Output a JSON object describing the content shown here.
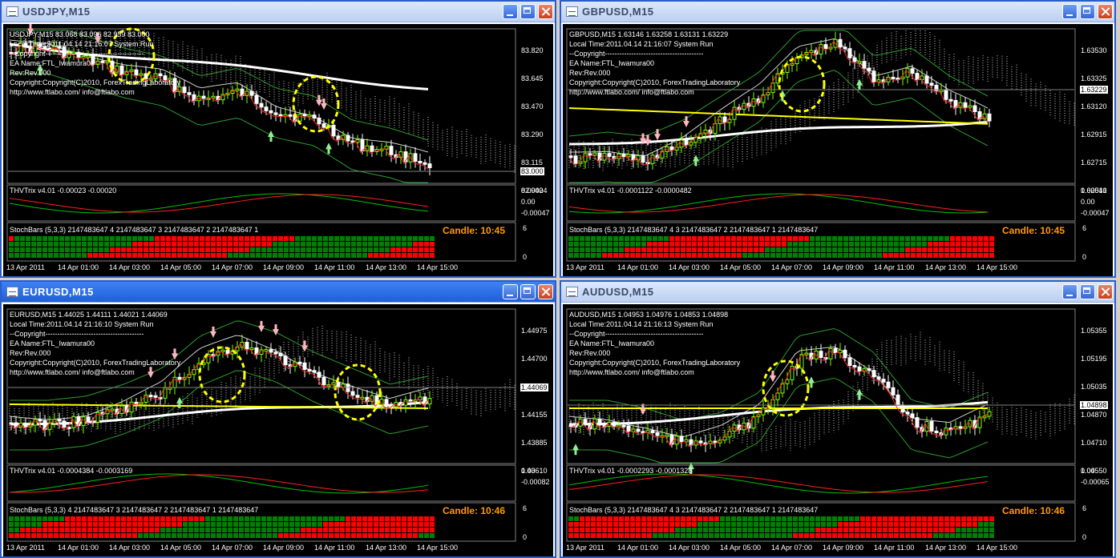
{
  "windows": [
    {
      "id": "usdjpy",
      "title": "USDJPY,M15",
      "active": false,
      "info": [
        "USDJPY,M15  83.068 83.096 82.959 83.000",
        "Local Time:2011.04.14 21:16:07 System Run",
        "--Copyright-----------------------------------------",
        "EA Name:FTL_Iwamura00",
        "Rev:Rev.000",
        "Copyright:Copyright(C)2010, ForexTradingLaboratory",
        "http://www.ftlabo.com/ info@ftlabo.com"
      ],
      "price_scale": [
        "83.820",
        "83.645",
        "83.470",
        "83.290",
        "83.115",
        "82.940"
      ],
      "price_tag": "83.000",
      "trix_label": "THVTrix v4.01 -0.00023 -0.00020",
      "trix_scale": [
        "0.00024",
        "0.00",
        "-0.00047"
      ],
      "stoch_label": "StochBars (5,3,3) 2147483647 4 2147483647 3 2147483647 2 2147483647 1",
      "stoch_scale": [
        "6",
        "0"
      ],
      "candle_label": "Candle:  10:45",
      "times": [
        "13 Apr 2011",
        "14 Apr 01:00",
        "14 Apr 03:00",
        "14 Apr 05:00",
        "14 Apr 07:00",
        "14 Apr 09:00",
        "14 Apr 11:00",
        "14 Apr 13:00",
        "14 Apr 15:00"
      ]
    },
    {
      "id": "gbpusd",
      "title": "GBPUSD,M15",
      "active": false,
      "info": [
        "GBPUSD,M15  1.63146 1.63258 1.63131 1.63229",
        "Local Time:2011.04.14 21:16:07 System Run",
        "--Copyright-----------------------------------------",
        "EA Name:FTL_Iwamura00",
        "Rev:Rev.000",
        "Copyright:Copyright(C)2010, ForexTradingLaboratory",
        "http://www.ftlabo.com/ info@ftlabo.com"
      ],
      "price_scale": [
        "1.63530",
        "1.63325",
        "1.63120",
        "1.62915",
        "1.62715",
        "1.62510"
      ],
      "price_tag": "1.63229",
      "trix_label": "THVTrix v4.01 -0.0001122 -0.0000482",
      "trix_scale": [
        "0.00041",
        "0.00",
        "-0.00047"
      ],
      "stoch_label": "StochBars (5,3,3) 2147483647 4 3 2147483647 2 2147483647 1 2147483647",
      "stoch_scale": [
        "6",
        "0"
      ],
      "candle_label": "Candle:  10:45",
      "times": [
        "13 Apr 2011",
        "14 Apr 01:00",
        "14 Apr 03:00",
        "14 Apr 05:00",
        "14 Apr 07:00",
        "14 Apr 09:00",
        "14 Apr 11:00",
        "14 Apr 13:00",
        "14 Apr 15:00"
      ]
    },
    {
      "id": "eurusd",
      "title": "EURUSD,M15",
      "active": true,
      "info": [
        "EURUSD,M15  1.44025 1.44111 1.44021 1.44069",
        "Local Time:2011.04.14 21:16:10 System Run",
        "--Copyright-----------------------------------------",
        "EA Name:FTL_Iwamura00",
        "Rev:Rev.000",
        "Copyright:Copyright(C)2010, ForexTradingLaboratory",
        "http://www.ftlabo.com/ info@ftlabo.com"
      ],
      "price_scale": [
        "1.44975",
        "1.44700",
        "1.44420",
        "1.44155",
        "1.43885",
        "1.43610"
      ],
      "price_tag": "1.44069",
      "trix_label": "THVTrix v4.01 -0.0004384 -0.0003169",
      "trix_scale": [
        "0.00",
        "-0.00082"
      ],
      "stoch_label": "StochBars (5,3,3) 4 2147483647 3 2147483647 2 2147483647 1 2147483647",
      "stoch_scale": [
        "6",
        "0"
      ],
      "candle_label": "Candle:  10:46",
      "times": [
        "13 Apr 2011",
        "14 Apr 01:00",
        "14 Apr 03:00",
        "14 Apr 05:00",
        "14 Apr 07:00",
        "14 Apr 09:00",
        "14 Apr 11:00",
        "14 Apr 13:00",
        "14 Apr 15:00"
      ]
    },
    {
      "id": "audusd",
      "title": "AUDUSD,M15",
      "active": false,
      "info": [
        "AUDUSD,M15  1.04953 1.04976 1.04853 1.04898",
        "Local Time:2011.04.14 21:16:13 System Run",
        "--Copyright-----------------------------------------",
        "EA Name:FTL_Iwamura00",
        "Rev:Rev.000",
        "Copyright:Copyright(C)2010, ForexTradingLaboratory",
        "http://www.ftlabo.com/ info@ftlabo.com"
      ],
      "price_scale": [
        "1.05355",
        "1.05195",
        "1.05035",
        "1.04870",
        "1.04710",
        "1.04550"
      ],
      "price_tag": "1.04898",
      "trix_label": "THVTrix v4.01 -0.0002293 -0.0001328",
      "trix_scale": [
        "0.00",
        "-0.00065"
      ],
      "stoch_label": "StochBars (5,3,3) 2147483647 4 3 2147483647 2 2147483647 1 2147483647",
      "stoch_scale": [
        "6",
        "0"
      ],
      "candle_label": "Candle:  10:46",
      "times": [
        "13 Apr 2011",
        "14 Apr 01:00",
        "14 Apr 03:00",
        "14 Apr 05:00",
        "14 Apr 07:00",
        "14 Apr 09:00",
        "14 Apr 11:00",
        "14 Apr 13:00",
        "14 Apr 15:00"
      ]
    }
  ],
  "colors": {
    "bull": "#7fff00",
    "bear": "#ffffff",
    "ma_red": "#ff2020",
    "ma_white": "#ffffff",
    "ma_yellow": "#ffff00",
    "band_green": "#2e9c2e",
    "stoch_red": "#ff0000",
    "stoch_green": "#008000",
    "highlight": "#ffff00",
    "arrow_up": "#90ee90",
    "arrow_down": "#ffb6c1"
  }
}
